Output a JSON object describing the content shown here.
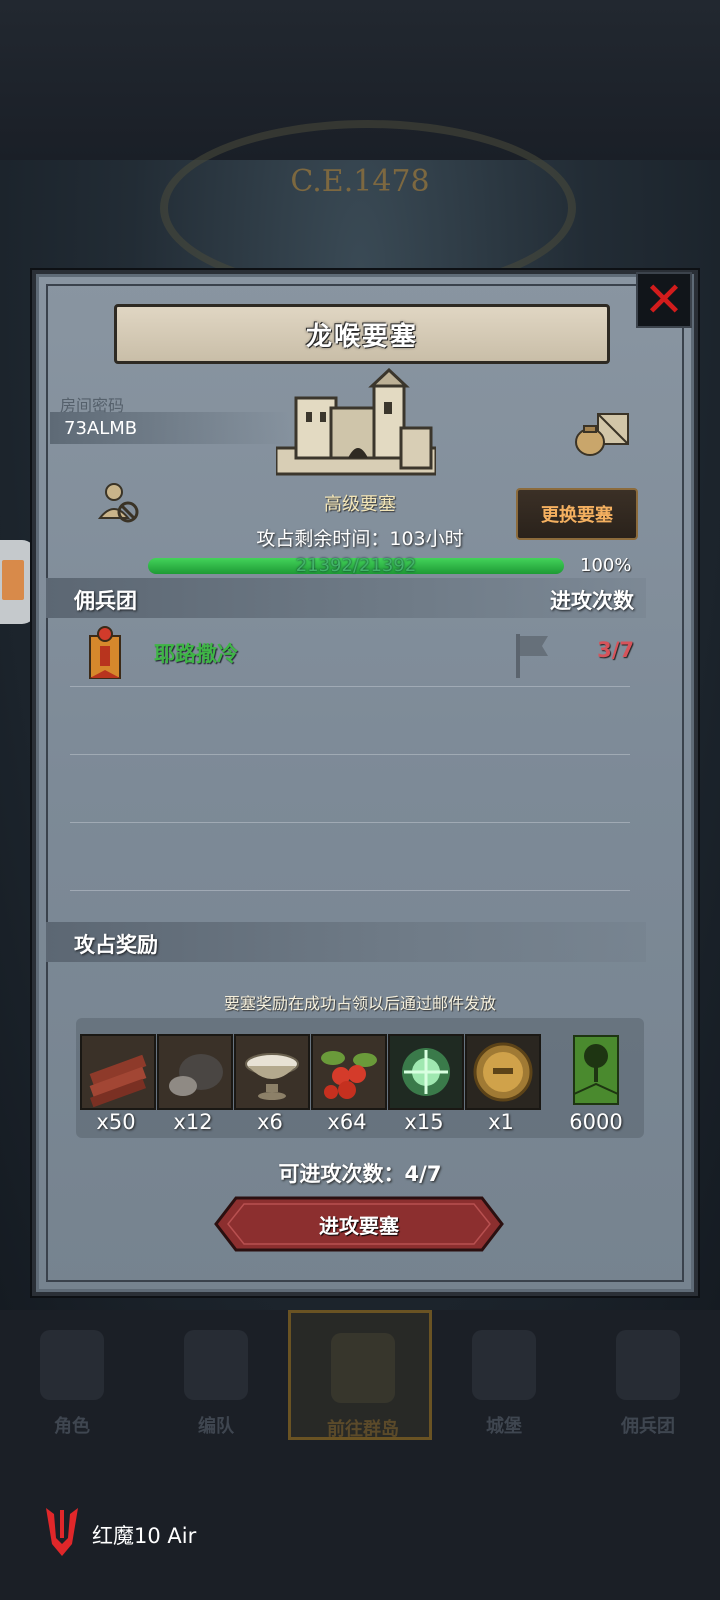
{
  "background": {
    "era": "C.E.1478"
  },
  "dialog": {
    "title": "龙喉要塞",
    "close_icon": "close-x-icon",
    "room": {
      "label": "房间密码",
      "code": "73ALMB"
    },
    "fortress": {
      "grade": "高级要塞",
      "change_button": "更换要塞"
    },
    "time_left": "攻占剩余时间：103小时",
    "hp": {
      "text": "21392/21392",
      "percent_label": "100%",
      "fraction": 1.0
    },
    "mercenary_section": {
      "header": "佣兵团",
      "header_right": "进攻次数",
      "rows": [
        {
          "name": "耶路撒冷",
          "attacks": "3/7"
        }
      ]
    },
    "reward_section": {
      "header": "攻占奖励",
      "note": "要塞奖励在成功占领以后通过邮件发放",
      "items": [
        {
          "icon": "wood-planks-icon",
          "qty": "x50"
        },
        {
          "icon": "truffle-icon",
          "qty": "x12"
        },
        {
          "icon": "bowl-icon",
          "qty": "x6"
        },
        {
          "icon": "berries-icon",
          "qty": "x64"
        },
        {
          "icon": "green-emblem-icon",
          "qty": "x15"
        },
        {
          "icon": "gold-helmet-coin-icon",
          "qty": "x1"
        },
        {
          "icon": "tree-banner-icon",
          "qty": "6000"
        }
      ]
    },
    "attacks_left": "可进攻次数：4/7",
    "attack_button": "进攻要塞"
  },
  "nav": {
    "items": [
      {
        "label": "角色",
        "icon": "knight-icon"
      },
      {
        "label": "编队",
        "icon": "formation-icon"
      },
      {
        "label": "前往群岛",
        "icon": "islands-icon"
      },
      {
        "label": "城堡",
        "icon": "castle-icon"
      },
      {
        "label": "佣兵团",
        "icon": "mercenary-icon"
      }
    ]
  },
  "device": {
    "name": "红魔10 Air"
  },
  "colors": {
    "hp_green": "#2fb84a",
    "accent_orange": "#f4b060",
    "attack_red": "#8c2f2f"
  }
}
